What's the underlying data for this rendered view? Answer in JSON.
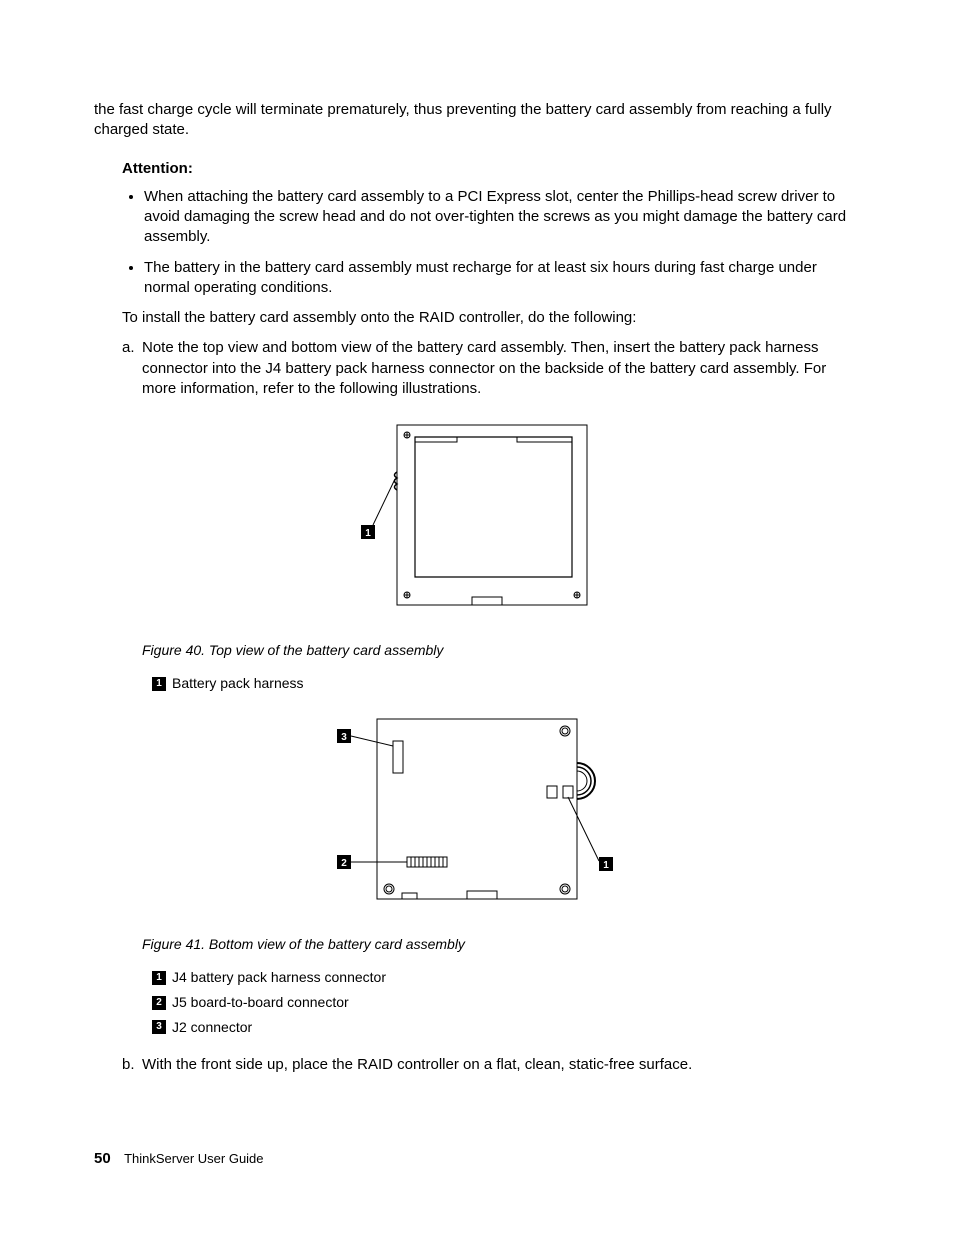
{
  "continuation_para": "the fast charge cycle will terminate prematurely, thus preventing the battery card assembly from reaching a fully charged state.",
  "attention_label": "Attention:",
  "attention_bullets": [
    "When attaching the battery card assembly to a PCI Express slot, center the Phillips-head screw driver to avoid damaging the screw head and do not over-tighten the screws as you might damage the battery card assembly.",
    "The battery in the battery card assembly must recharge for at least six hours during fast charge under normal operating conditions."
  ],
  "install_intro": "To install the battery card assembly onto the RAID controller, do the following:",
  "steps": {
    "a": {
      "marker": "a.",
      "text": "Note the top view and bottom view of the battery card assembly. Then, insert the battery pack harness connector into the J4 battery pack harness connector on the backside of the battery card assembly. For more information, refer to the following illustrations."
    },
    "b": {
      "marker": "b.",
      "text": "With the front side up, place the RAID controller on a flat, clean, static-free surface."
    }
  },
  "figure40": {
    "caption": "Figure 40. Top view of the battery card assembly",
    "callouts": [
      {
        "num": "1",
        "label": "Battery pack harness"
      }
    ]
  },
  "figure41": {
    "caption": "Figure 41. Bottom view of the battery card assembly",
    "callouts": [
      {
        "num": "1",
        "label": "J4 battery pack harness connector"
      },
      {
        "num": "2",
        "label": "J5 board-to-board connector"
      },
      {
        "num": "3",
        "label": "J2 connector"
      }
    ]
  },
  "footer": {
    "page_num": "50",
    "doc_title": "ThinkServer User Guide"
  }
}
